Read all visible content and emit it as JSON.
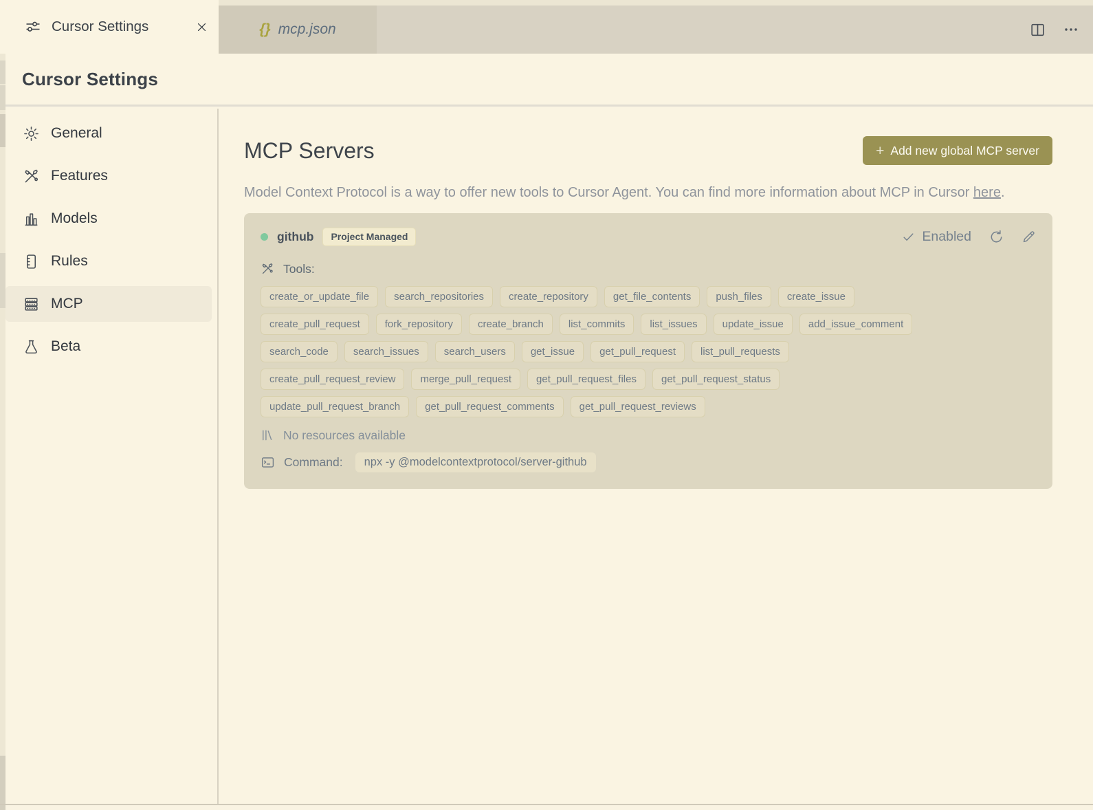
{
  "tabs": {
    "settings": {
      "label": "Cursor Settings"
    },
    "preview": {
      "label": "mcp.json",
      "icon_text": "{}"
    }
  },
  "page": {
    "title": "Cursor Settings"
  },
  "sidebar": {
    "items": [
      {
        "label": "General"
      },
      {
        "label": "Features"
      },
      {
        "label": "Models"
      },
      {
        "label": "Rules"
      },
      {
        "label": "MCP",
        "active": true
      },
      {
        "label": "Beta"
      }
    ]
  },
  "main": {
    "title": "MCP Servers",
    "add_button": {
      "plus": "+",
      "label": "Add new global MCP server"
    },
    "description": {
      "before": "Model Context Protocol is a way to offer new tools to Cursor Agent. You can find more information about MCP in Cursor ",
      "link": "here",
      "after": "."
    }
  },
  "server_card": {
    "name": "github",
    "badge": "Project Managed",
    "status_label": "Enabled",
    "tools_label": "Tools:",
    "tool_rows": [
      [
        "create_or_update_file",
        "search_repositories",
        "create_repository",
        "get_file_contents",
        "push_files",
        "create_issue"
      ],
      [
        "create_pull_request",
        "fork_repository",
        "create_branch",
        "list_commits",
        "list_issues",
        "update_issue",
        "add_issue_comment"
      ],
      [
        "search_code",
        "search_issues",
        "search_users",
        "get_issue",
        "get_pull_request",
        "list_pull_requests"
      ],
      [
        "create_pull_request_review",
        "merge_pull_request",
        "get_pull_request_files",
        "get_pull_request_status"
      ],
      [
        "update_pull_request_branch",
        "get_pull_request_comments",
        "get_pull_request_reviews"
      ]
    ],
    "resources_text": "No resources available",
    "command_label": "Command:",
    "command_value": "npx -y @modelcontextprotocol/server-github"
  },
  "colors": {
    "accent_olive": "#9A9253",
    "status_green": "#80C99E",
    "json_olive": "#A9A33E",
    "background_cream": "#FAF4E2",
    "card_beige": "#DDD7C1"
  }
}
